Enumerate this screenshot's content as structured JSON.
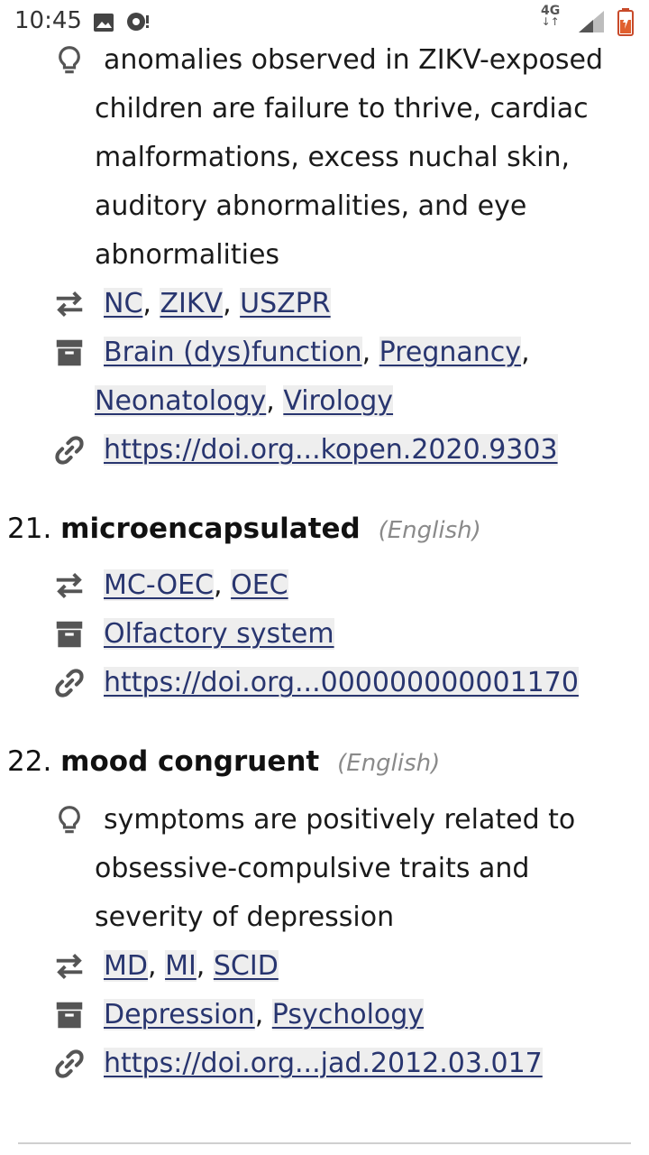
{
  "status_bar": {
    "time": "10:45",
    "network": "4G",
    "network_arrows": "↓↑"
  },
  "entry_prev": {
    "description": "anomalies observed in ZIKV-exposed children are failure to thrive, cardiac malformations, excess nuchal skin, auditory abnormalities, and eye abnormalities",
    "abbreviations": [
      "NC",
      "ZIKV",
      "USZPR"
    ],
    "categories": [
      "Brain (dys)function",
      "Pregnancy",
      "Neonatology",
      "Virology"
    ],
    "doi": "https://doi.org...kopen.2020.9303"
  },
  "entry_21": {
    "number": "21.",
    "term": "microencapsulated",
    "language": "(English)",
    "abbreviations": [
      "MC-OEC",
      "OEC"
    ],
    "categories": [
      "Olfactory system"
    ],
    "doi": "https://doi.org...000000000001170"
  },
  "entry_22": {
    "number": "22.",
    "term": "mood congruent",
    "language": "(English)",
    "description": "symptoms are positively related to obsessive-compulsive traits and severity of depression",
    "abbreviations": [
      "MD",
      "MI",
      "SCID"
    ],
    "categories": [
      "Depression",
      "Psychology"
    ],
    "doi": "https://doi.org...jad.2012.03.017"
  },
  "colors": {
    "link": "#28356f",
    "icon": "#555555",
    "language_tag": "#8a8a8a"
  },
  "icons": {
    "description": "lightbulb-icon",
    "abbreviations": "swap-arrows-icon",
    "categories": "archive-box-icon",
    "doi": "link-icon"
  }
}
